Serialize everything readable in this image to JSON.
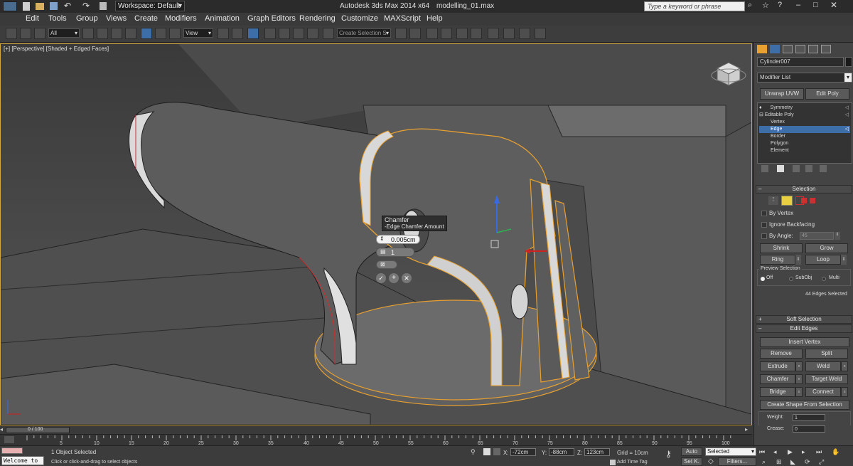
{
  "title_bar": {
    "workspace": "Workspace: Default",
    "app_title": "Autodesk 3ds Max  2014 x64",
    "file_name": "modelling_01.max",
    "search_placeholder": "Type a keyword or phrase"
  },
  "menu": [
    "Edit",
    "Tools",
    "Group",
    "Views",
    "Create",
    "Modifiers",
    "Animation",
    "Graph Editors",
    "Rendering",
    "Customize",
    "MAXScript",
    "Help"
  ],
  "toolbar": {
    "filter_value": "All",
    "coord_value": "View",
    "selection_set_placeholder": "Create Selection S"
  },
  "viewport": {
    "label": "[+] [Perspective] [Shaded + Edged Faces]",
    "caddy": {
      "title": "Chamfer",
      "subtitle": "-Edge Chamfer Amount",
      "amount": "0.005cm",
      "segments": "1"
    }
  },
  "command_panel": {
    "object_name": "Cylinder007",
    "modifier_list": "Modifier List",
    "unwrap_button": "Unwrap UVW",
    "edit_poly_button": "Edit Poly",
    "stack": [
      {
        "label": "Symmetry",
        "indent": false,
        "selected": false
      },
      {
        "label": "Editable Poly",
        "indent": false,
        "selected": false
      },
      {
        "label": "Vertex",
        "indent": true,
        "selected": false
      },
      {
        "label": "Edge",
        "indent": true,
        "selected": true
      },
      {
        "label": "Border",
        "indent": true,
        "selected": false
      },
      {
        "label": "Polygon",
        "indent": true,
        "selected": false
      },
      {
        "label": "Element",
        "indent": true,
        "selected": false
      }
    ],
    "selection": {
      "header": "Selection",
      "by_vertex": "By Vertex",
      "ignore_backfacing": "Ignore Backfacing",
      "by_angle": "By Angle:",
      "angle_value": "45",
      "shrink": "Shrink",
      "grow": "Grow",
      "ring": "Ring",
      "loop": "Loop",
      "preview_title": "Preview Selection",
      "preview_options": [
        "Off",
        "SubObj",
        "Multi"
      ],
      "status": "44 Edges Selected"
    },
    "soft_selection": "Soft Selection",
    "edit_edges": {
      "header": "Edit Edges",
      "insert_vertex": "Insert Vertex",
      "remove": "Remove",
      "split": "Split",
      "extrude": "Extrude",
      "weld": "Weld",
      "chamfer": "Chamfer",
      "target_weld": "Target Weld",
      "bridge": "Bridge",
      "connect": "Connect",
      "create_shape": "Create Shape From Selection",
      "weight_label": "Weight:",
      "weight_value": "1",
      "crease_label": "Crease:",
      "crease_value": "0"
    }
  },
  "timeline": {
    "frame_counter": "0 / 100",
    "ticks": [
      "0",
      "5",
      "10",
      "15",
      "20",
      "25",
      "30",
      "35",
      "40",
      "45",
      "50",
      "55",
      "60",
      "65",
      "70",
      "75",
      "80",
      "85",
      "90",
      "95",
      "100"
    ]
  },
  "status_bar": {
    "listener": "Welcome to",
    "selected_info": "1 Object Selected",
    "prompt": "Click or click-and-drag to select objects",
    "x_label": "X:",
    "x_value": "-72cm",
    "y_label": "Y:",
    "y_value": "-88cm",
    "z_label": "Z:",
    "z_value": "123cm",
    "grid": "Grid = 10cm",
    "add_time_tag": "Add Time Tag",
    "auto": "Auto",
    "selected_dropdown": "Selected",
    "set_k": "Set K.",
    "filters": "Filters..."
  },
  "colors": {
    "selection_orange": "#e8a030",
    "ui_dark": "#3c3c3c",
    "highlight_blue": "#3d6ea8"
  }
}
